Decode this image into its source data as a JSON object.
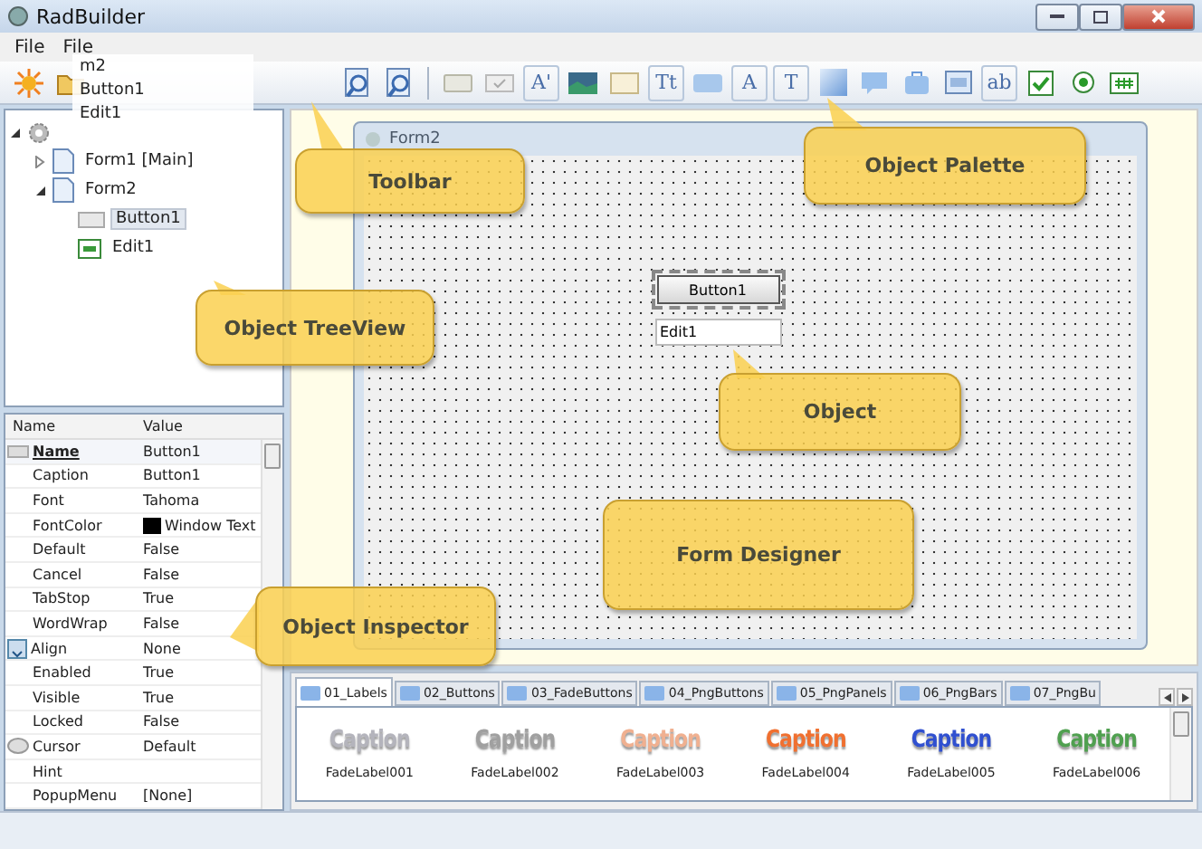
{
  "window": {
    "title": "RadBuilder"
  },
  "menu": [
    "File",
    "File"
  ],
  "drag_ghost": [
    "m2",
    "Button1",
    "Edit1"
  ],
  "toolbar": [
    {
      "kind": "new"
    },
    {
      "kind": "open"
    },
    {
      "kind": "zoom"
    },
    {
      "kind": "zoom"
    }
  ],
  "palette": [
    {
      "kind": "button"
    },
    {
      "kind": "check-box"
    },
    {
      "kind": "glyph",
      "glyph": "A'"
    },
    {
      "kind": "image"
    },
    {
      "kind": "panel"
    },
    {
      "kind": "glyph",
      "glyph": "Tt"
    },
    {
      "kind": "shape"
    },
    {
      "kind": "glyph",
      "glyph": "A"
    },
    {
      "kind": "glyph",
      "glyph": "T"
    },
    {
      "kind": "gradient"
    },
    {
      "kind": "bubble"
    },
    {
      "kind": "bag"
    },
    {
      "kind": "window"
    },
    {
      "kind": "glyph",
      "glyph": "ab"
    },
    {
      "kind": "check"
    },
    {
      "kind": "radio"
    },
    {
      "kind": "grid"
    }
  ],
  "tree": [
    {
      "kind": "project",
      "expanded": true,
      "children": [
        {
          "label": "Form1 [Main]",
          "kind": "form",
          "expanded": false
        },
        {
          "label": "Form2",
          "kind": "form",
          "expanded": true,
          "children": [
            {
              "label": "Button1",
              "kind": "button",
              "selected": true
            },
            {
              "label": "Edit1",
              "kind": "edit",
              "selected": false
            }
          ]
        }
      ]
    }
  ],
  "inspector": {
    "columns": [
      "Name",
      "Value"
    ],
    "rows": [
      {
        "name": "Name",
        "value": "Button1",
        "kind": "key",
        "selected": true
      },
      {
        "name": "Caption",
        "value": "Button1",
        "kind": "plain",
        "selected": false
      },
      {
        "name": "Font",
        "value": "Tahoma",
        "kind": "plain",
        "selected": false
      },
      {
        "name": "FontColor",
        "value": "Window Text",
        "kind": "color",
        "selected": false
      },
      {
        "name": "Default",
        "value": "False",
        "kind": "plain",
        "selected": false
      },
      {
        "name": "Cancel",
        "value": "False",
        "kind": "plain",
        "selected": false
      },
      {
        "name": "TabStop",
        "value": "True",
        "kind": "plain",
        "selected": false
      },
      {
        "name": "WordWrap",
        "value": "False",
        "kind": "plain",
        "selected": false
      },
      {
        "name": "Align",
        "value": "None",
        "kind": "align",
        "selected": false
      },
      {
        "name": "Enabled",
        "value": "True",
        "kind": "plain",
        "selected": false
      },
      {
        "name": "Visible",
        "value": "True",
        "kind": "plain",
        "selected": false
      },
      {
        "name": "Locked",
        "value": "False",
        "kind": "plain",
        "selected": false
      },
      {
        "name": "Cursor",
        "value": "Default",
        "kind": "cursor",
        "selected": false
      },
      {
        "name": "Hint",
        "value": "",
        "kind": "plain",
        "selected": false
      },
      {
        "name": "PopupMenu",
        "value": "[None]",
        "kind": "plain",
        "selected": false
      }
    ]
  },
  "form": {
    "title": "Form2",
    "button": {
      "label": "Button1",
      "selected": true
    },
    "edit": {
      "value": "Edit1"
    }
  },
  "callouts": [
    "Toolbar",
    "Object Palette",
    "Object TreeView",
    "Object",
    "Form Designer",
    "Object Inspector"
  ],
  "gallery": {
    "tabs": [
      {
        "label": "01_Labels",
        "selected": true
      },
      {
        "label": "02_Buttons",
        "selected": false
      },
      {
        "label": "03_FadeButtons",
        "selected": false
      },
      {
        "label": "04_PngButtons",
        "selected": false
      },
      {
        "label": "05_PngPanels",
        "selected": false
      },
      {
        "label": "06_PngBars",
        "selected": false
      },
      {
        "label": "07_PngBu",
        "selected": false
      }
    ],
    "items": [
      {
        "caption": "Caption",
        "label": "FadeLabel001",
        "color": "#b4b4bc"
      },
      {
        "caption": "Caption",
        "label": "FadeLabel002",
        "color": "#a0a0a0"
      },
      {
        "caption": "Caption",
        "label": "FadeLabel003",
        "color": "#f0b090"
      },
      {
        "caption": "Caption",
        "label": "FadeLabel004",
        "color": "#f07030"
      },
      {
        "caption": "Caption",
        "label": "FadeLabel005",
        "color": "#3050d0"
      },
      {
        "caption": "Caption",
        "label": "FadeLabel006",
        "color": "#50a050"
      }
    ]
  }
}
